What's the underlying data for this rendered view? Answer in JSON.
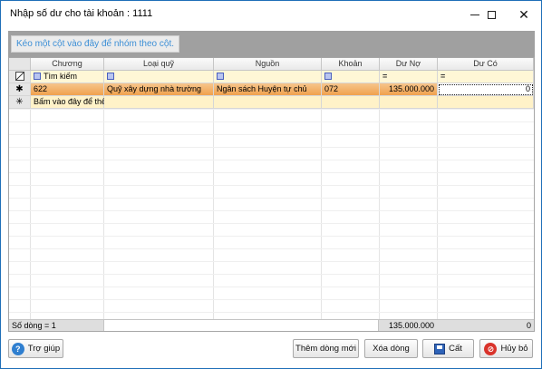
{
  "window": {
    "title": "Nhập số dư cho tài khoản : 1111"
  },
  "group_panel": {
    "hint": "Kéo một cột vào đây để nhóm theo cột."
  },
  "grid": {
    "columns": [
      "Chương",
      "Loại quỹ",
      "Nguồn",
      "Khoản",
      "Dư Nợ",
      "Dư Có"
    ],
    "filter_row": {
      "search_placeholder": "Tìm kiếm",
      "eq": "="
    },
    "rows": [
      {
        "chuong": "622",
        "loai_quy": "Quỹ xây dựng nhà trường",
        "nguon": "Ngân sách Huyện tự chủ",
        "khoan": "072",
        "du_no": "135.000.000",
        "du_co": "0"
      }
    ],
    "new_row_label": "Bấm vào đây để thêm mới",
    "footer": {
      "row_count": "Số dòng = 1",
      "total_du_no": "135.000.000",
      "total_du_co": "0"
    }
  },
  "buttons": {
    "help": "Trợ giúp",
    "add_new": "Thêm dòng mới",
    "delete_row": "Xóa dòng",
    "save": "Cất",
    "cancel": "Hủy bỏ"
  },
  "icons": {
    "minimize": "minimize-icon",
    "maximize": "maximize-icon",
    "close": "close-icon",
    "help": "help-icon",
    "save": "floppy-disk-icon",
    "cancel": "cancel-icon"
  },
  "colors": {
    "selected_row": "#f0a14e",
    "filter_row": "#fff7d6",
    "group_panel": "#a0a0a0",
    "hint_text": "#3c8fd6"
  }
}
